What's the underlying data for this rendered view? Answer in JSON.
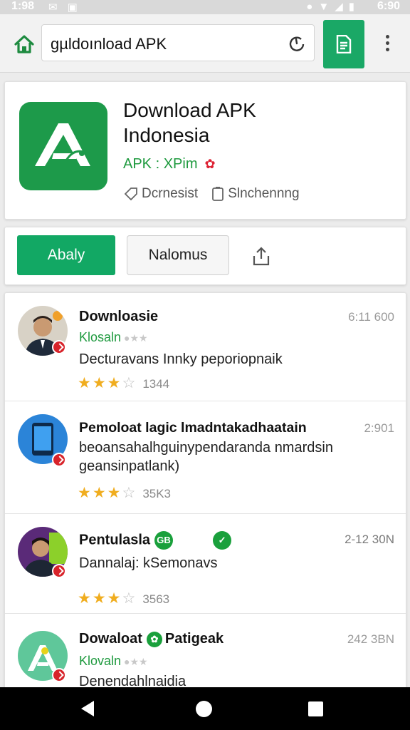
{
  "status": {
    "time_left": "1:98",
    "time_right": "6:90"
  },
  "toolbar": {
    "url": "gµldoınload APK"
  },
  "app": {
    "title": "Download APK Indonesia",
    "meta": "APK : XPim",
    "info_left": "Dcrnesist",
    "info_right": "Slnchennng"
  },
  "actions": {
    "primary": "Abaly",
    "secondary": "Nalomus"
  },
  "items": [
    {
      "title": "Downloasie",
      "subtitle": "Klosaln",
      "description": "Decturavans Innky peporiopnaik",
      "time": "6:11 600",
      "count": "1344"
    },
    {
      "title": "Pemoloat lagic lmadntakadhaatain",
      "description": "beoansahalhguinypendaranda nmardsin",
      "description2": "geansinpatlank)",
      "time": "2:901",
      "count": "35K3"
    },
    {
      "title": "Pentulasla",
      "description": "Dannalaj: kSemonavs",
      "time": "2-12 30N",
      "count": "3563"
    },
    {
      "title": "Dowaloat",
      "title_suffix": "Patigeak",
      "subtitle": "Klovaln",
      "description": "Denendahlnaidia",
      "time": "242 3BN"
    }
  ],
  "colors": {
    "accent": "#12a864",
    "brand_green": "#1d9a4a",
    "star": "#f0ad1f",
    "badge_red": "#d8232a"
  }
}
